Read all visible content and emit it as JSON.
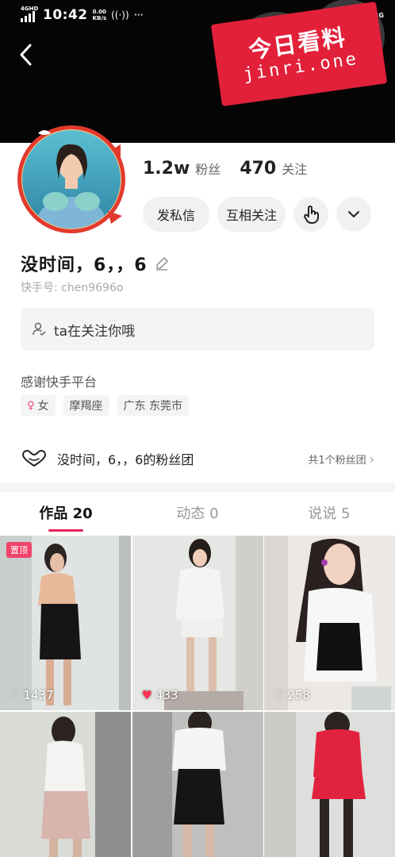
{
  "status_bar": {
    "network_label": "4GHD",
    "time": "10:42",
    "speed_value": "0.00",
    "speed_unit": "KB/s",
    "more": "···",
    "right_network": "4G"
  },
  "watermark": {
    "title": "今日看料",
    "subtitle": "jinri.one"
  },
  "profile": {
    "followers_value": "1.2w",
    "followers_label": "粉丝",
    "following_value": "470",
    "following_label": "关注",
    "message_button": "发私信",
    "mutual_button": "互相关注",
    "name": "没时间，6，，6",
    "user_id": "快手号: chen9696o",
    "follow_notice": "ta在关注你哦",
    "bio": "感谢快手平台",
    "tags": {
      "gender": "女",
      "zodiac": "摩羯座",
      "location": "广东 东莞市"
    },
    "fan_group_name": "没时间，6，，6的粉丝团",
    "fan_group_count": "共1个粉丝团"
  },
  "tabs": [
    {
      "label": "作品 20",
      "active": true
    },
    {
      "label": "动态 0",
      "active": false
    },
    {
      "label": "说说 5",
      "active": false
    }
  ],
  "videos": [
    {
      "pinned_label": "置顶",
      "likes": "1437",
      "liked": false
    },
    {
      "pinned_label": "",
      "likes": "433",
      "liked": true
    },
    {
      "pinned_label": "",
      "likes": "258",
      "liked": false
    },
    {
      "pinned_label": "",
      "likes": "",
      "liked": false
    },
    {
      "pinned_label": "",
      "likes": "",
      "liked": false
    },
    {
      "pinned_label": "",
      "likes": "",
      "liked": false
    }
  ],
  "colors": {
    "accent": "#e8235a",
    "header_bg": "#050505",
    "pill_bg": "#f1f1f2",
    "watermark": "#e2203a"
  },
  "icons": [
    "back-arrow-icon",
    "pencil-icon",
    "hand-icon",
    "chevron-down-icon",
    "user-follow-icon",
    "fan-heart-icon",
    "heart-icon"
  ]
}
